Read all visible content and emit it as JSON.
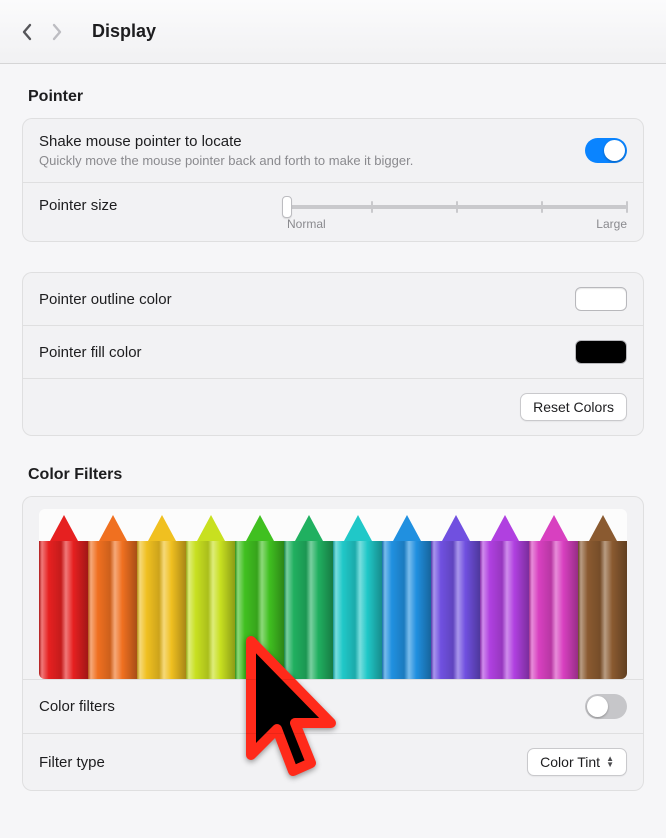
{
  "page_title": "Display",
  "sections": {
    "pointer": {
      "title": "Pointer",
      "shake": {
        "label": "Shake mouse pointer to locate",
        "sub": "Quickly move the mouse pointer back and forth to make it bigger.",
        "on": true
      },
      "size": {
        "label": "Pointer size",
        "min_label": "Normal",
        "max_label": "Large",
        "value": 0,
        "ticks": 5
      },
      "outline": {
        "label": "Pointer outline color",
        "color": "#ffffff"
      },
      "fill": {
        "label": "Pointer fill color",
        "color": "#000000"
      },
      "reset_label": "Reset Colors"
    },
    "color_filters": {
      "title": "Color Filters",
      "enable": {
        "label": "Color filters",
        "on": false
      },
      "filter_type": {
        "label": "Filter type",
        "value": "Color Tint"
      },
      "pencil_colors": [
        "#e62020",
        "#f07020",
        "#f0c020",
        "#c8e020",
        "#40c020",
        "#20b060",
        "#20c8c8",
        "#2090e0",
        "#7050e0",
        "#b040e0",
        "#d840c0",
        "#8a5a30"
      ]
    }
  }
}
